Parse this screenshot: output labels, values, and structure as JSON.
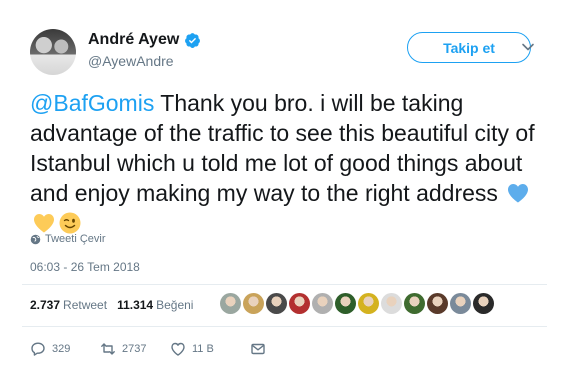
{
  "user": {
    "name": "André Ayew",
    "handle": "@AyewAndre",
    "verified": true
  },
  "follow_button": {
    "label": "Takip et"
  },
  "tweet": {
    "mention": "@BafGomis",
    "text": " Thank you bro. i will be taking advantage of the traffic to see this beautiful city of Istanbul which u told me lot of good things about and enjoy making my way to the right address",
    "emojis": [
      "blue-heart-icon",
      "yellow-heart-icon",
      "winking-face-icon"
    ]
  },
  "translate": {
    "label": "Tweeti Çevir"
  },
  "timestamp": "06:03 - 26 Tem 2018",
  "stats": {
    "retweets_count": "2.737",
    "retweets_label": "Retweet",
    "likes_count": "11.314",
    "likes_label": "Beğeni"
  },
  "liker_avatars": [
    "#9aa7a0",
    "#c9a35a",
    "#4a4a4a",
    "#b33030",
    "#b0b0b0",
    "#2e5e2a",
    "#d4b21f",
    "#dcdcdc",
    "#3f6b2f",
    "#5a3a2a",
    "#7a8a9a",
    "#2a2a2a"
  ],
  "actions": {
    "reply_count": "329",
    "retweet_count": "2737",
    "like_count": "11 B"
  },
  "colors": {
    "accent": "#1da1f2",
    "muted": "#657786",
    "text": "#14171a"
  }
}
